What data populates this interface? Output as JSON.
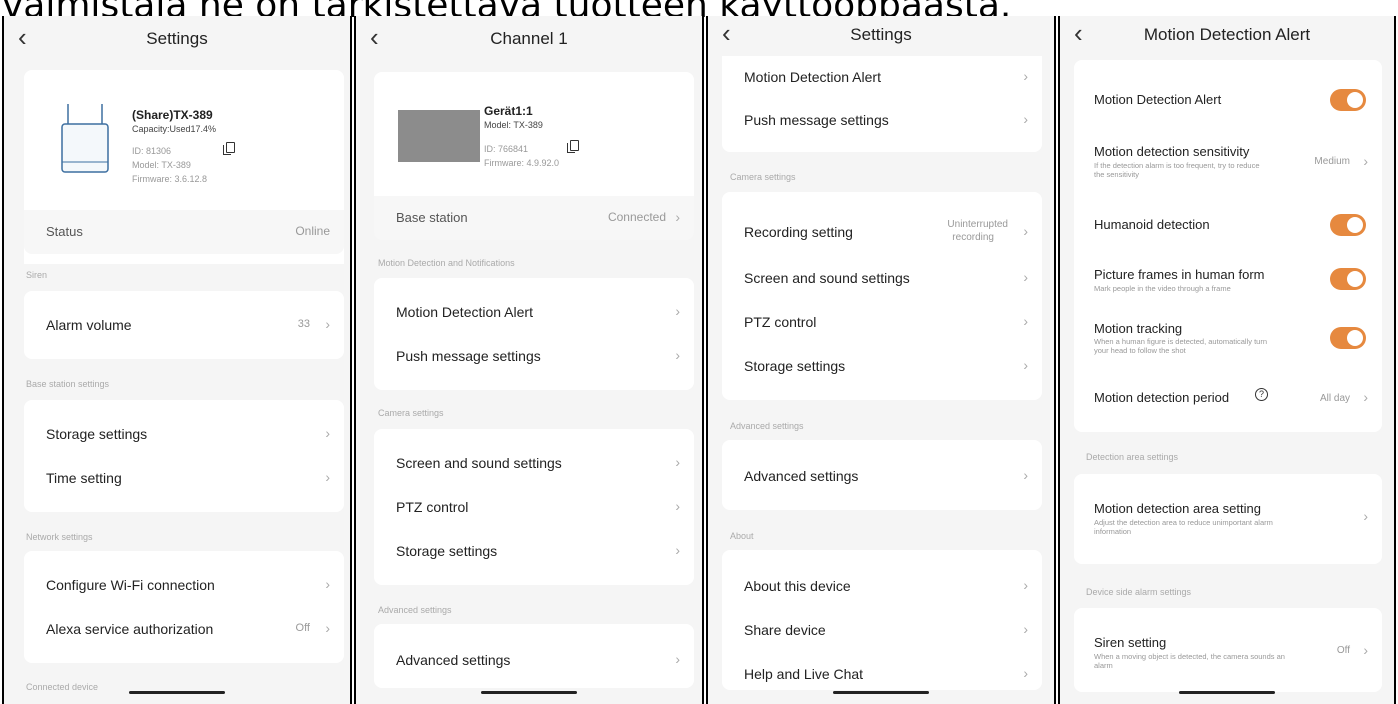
{
  "caption": "valmistaja ne on tarkistettava tuotteen käyttöoppaasta.",
  "icons": {
    "back": "back-arrow-icon",
    "chevron": "chevron-right-icon",
    "copy": "copy-icon",
    "help": "help-circle-icon",
    "toggle": "toggle-switch"
  },
  "colors": {
    "accent": "#e6893f",
    "background": "#f5f5f5",
    "card": "#ffffff"
  },
  "panel1": {
    "title": "Settings",
    "device": {
      "name": "(Share)TX-389",
      "capacity": "Capacity:Used17.4%",
      "id": "ID: 81306",
      "model": "Model: TX-389",
      "firmware": "Firmware: 3.6.12.8"
    },
    "status_label": "Status",
    "status_value": "Online",
    "siren_section": "Siren",
    "alarm_volume_label": "Alarm volume",
    "alarm_volume_value": "33",
    "base_section": "Base station settings",
    "storage_label": "Storage settings",
    "time_label": "Time setting",
    "network_section": "Network settings",
    "wifi_label": "Configure Wi-Fi connection",
    "alexa_label": "Alexa service authorization",
    "alexa_value": "Off",
    "connected_section": "Connected device"
  },
  "panel2": {
    "title": "Channel 1",
    "device": {
      "name": "Gerät1:1",
      "model": "Model: TX-389",
      "id": "ID: 766841",
      "firmware": "Firmware: 4.9.92.0"
    },
    "base_label": "Base station",
    "base_value": "Connected",
    "motion_section": "Motion Detection and Notifications",
    "motion_alert_label": "Motion Detection Alert",
    "push_label": "Push message settings",
    "camera_section": "Camera settings",
    "screen_label": "Screen and sound settings",
    "ptz_label": "PTZ control",
    "storage_label": "Storage settings",
    "advanced_section": "Advanced settings",
    "advanced_label": "Advanced settings"
  },
  "panel3": {
    "title": "Settings",
    "motion_alert_label": "Motion Detection Alert",
    "push_label": "Push message settings",
    "camera_section": "Camera settings",
    "recording_label": "Recording setting",
    "recording_value_1": "Uninterrupted",
    "recording_value_2": "recording",
    "screen_label": "Screen and sound settings",
    "ptz_label": "PTZ control",
    "storage_label": "Storage settings",
    "advanced_section": "Advanced settings",
    "advanced_label": "Advanced settings",
    "about_section": "About",
    "about_label": "About this device",
    "share_label": "Share device",
    "help_label": "Help and Live Chat"
  },
  "panel4": {
    "title": "Motion Detection Alert",
    "alert_label": "Motion Detection Alert",
    "sensitivity_label": "Motion detection sensitivity",
    "sensitivity_sub_1": "If the detection alarm is too frequent, try to reduce",
    "sensitivity_sub_2": "the sensitivity",
    "sensitivity_value": "Medium",
    "humanoid_label": "Humanoid detection",
    "frames_label": "Picture frames in human form",
    "frames_sub": "Mark people in the video through a frame",
    "tracking_label": "Motion tracking",
    "tracking_sub_1": "When a human figure is detected, automatically turn",
    "tracking_sub_2": "your head to follow the shot",
    "period_label": "Motion detection period",
    "period_value": "All day",
    "area_section": "Detection area settings",
    "area_label": "Motion detection area setting",
    "area_sub_1": "Adjust the detection area to reduce unimportant alarm",
    "area_sub_2": "information",
    "device_alarm_section": "Device side alarm settings",
    "siren_label": "Siren setting",
    "siren_sub_1": "When a moving object is detected, the camera sounds an",
    "siren_sub_2": "alarm",
    "siren_value": "Off"
  }
}
